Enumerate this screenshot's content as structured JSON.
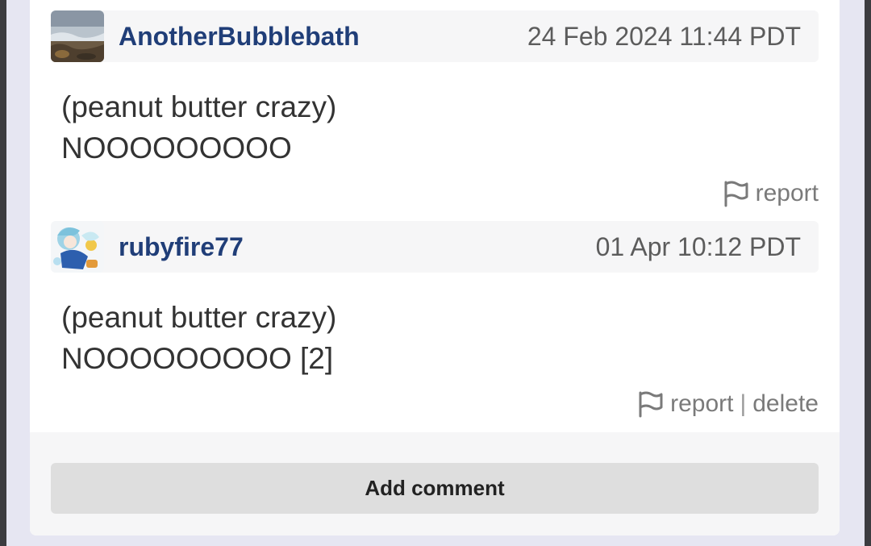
{
  "comments": [
    {
      "username": "AnotherBubblebath",
      "timestamp": "24 Feb 2024 11:44 PDT",
      "lines": [
        "(peanut butter crazy)",
        "NOOOOOOOOO"
      ],
      "report_label": "report"
    },
    {
      "username": "rubyfire77",
      "timestamp": "01 Apr 10:12 PDT",
      "lines": [
        "(peanut butter crazy)",
        "NOOOOOOOOO [2]"
      ],
      "report_label": "report",
      "separator": "|",
      "delete_label": "delete"
    }
  ],
  "footer": {
    "add_comment_label": "Add comment"
  },
  "colors": {
    "username": "#203e78",
    "header_bg": "#f6f6f7",
    "button_bg": "#dedede",
    "page_bg": "#e6e6f2"
  },
  "icons": {
    "report": "flag-icon"
  }
}
